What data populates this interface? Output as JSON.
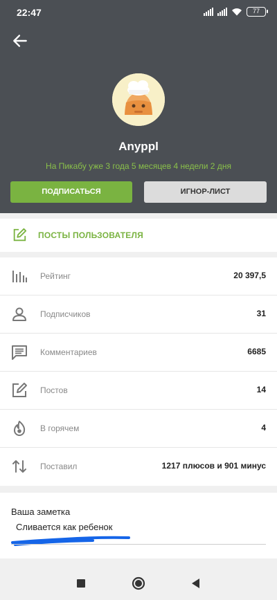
{
  "status_bar": {
    "time": "22:47",
    "battery": "77"
  },
  "header": {
    "username": "Anyppl",
    "since": "На Пикабу уже 3 года 5 месяцев 4 недели 2 дня",
    "subscribe_label": "ПОДПИСАТЬСЯ",
    "ignore_label": "ИГНОР-ЛИСТ"
  },
  "posts_link": {
    "label": "ПОСТЫ ПОЛЬЗОВАТЕЛЯ"
  },
  "stats": [
    {
      "icon": "rating-icon",
      "label": "Рейтинг",
      "value": "20 397,5"
    },
    {
      "icon": "subscribers-icon",
      "label": "Подписчиков",
      "value": "31"
    },
    {
      "icon": "comments-icon",
      "label": "Комментариев",
      "value": "6685"
    },
    {
      "icon": "posts-icon",
      "label": "Постов",
      "value": "14"
    },
    {
      "icon": "hot-icon",
      "label": "В горячем",
      "value": "4"
    },
    {
      "icon": "votes-icon",
      "label": "Поставил",
      "value": "1217 плюсов и 901 минус"
    }
  ],
  "note": {
    "title": "Ваша заметка",
    "text": "Сливается как ребенок"
  },
  "colors": {
    "header_bg": "#4b4f54",
    "accent_green": "#7ab341",
    "scribble_blue": "#1565e8"
  }
}
